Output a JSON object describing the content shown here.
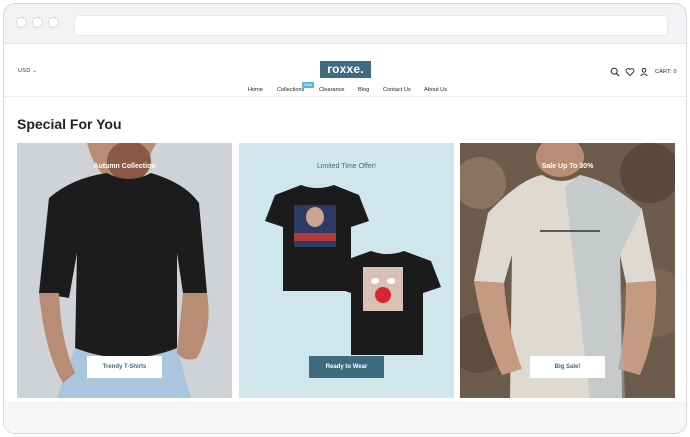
{
  "header": {
    "currency": "USD",
    "logo": "roxxe.",
    "cart_label": "CART: 0",
    "icons": [
      "search-icon",
      "heart-icon",
      "user-icon"
    ]
  },
  "nav": {
    "items": [
      "Home",
      "Collections",
      "Clearance",
      "Blog",
      "Contact Us",
      "About Us"
    ],
    "badge": "Sale"
  },
  "section": {
    "title": "Special For You"
  },
  "cards": [
    {
      "title": "Autumn Collection",
      "button": "Trendy T-Shirts"
    },
    {
      "title": "Limited Time Offer!",
      "button": "Ready to Wear"
    },
    {
      "title": "Sale Up To 30%",
      "button": "Big Sale!"
    }
  ],
  "colors": {
    "brand": "#3d6b80",
    "badge": "#52b6d6"
  }
}
